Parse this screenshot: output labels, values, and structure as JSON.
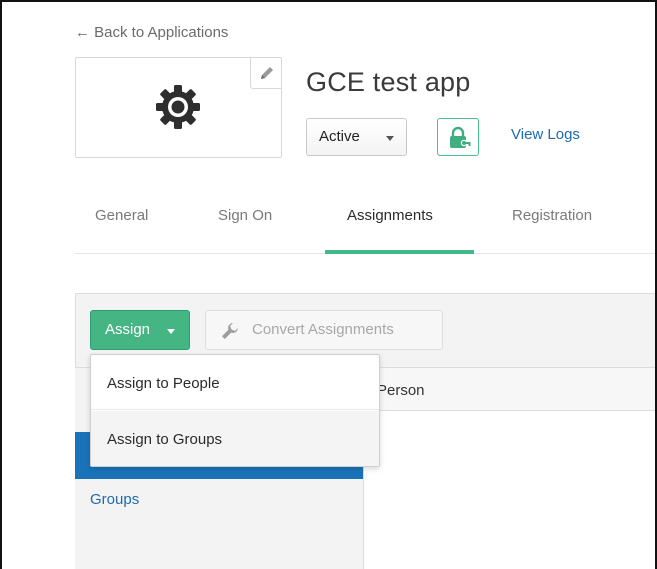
{
  "header": {
    "back_link": "← Back to Applications",
    "app_title": "GCE test app",
    "status": "Active",
    "view_logs": "View Logs"
  },
  "tabs": [
    {
      "label": "General",
      "active": false
    },
    {
      "label": "Sign On",
      "active": false
    },
    {
      "label": "Assignments",
      "active": true
    },
    {
      "label": "Registration",
      "active": false
    }
  ],
  "toolbar": {
    "assign_label": "Assign",
    "convert_label": "Convert Assignments"
  },
  "dropdown": {
    "items": [
      {
        "label": "Assign to People"
      },
      {
        "label": "Assign to Groups"
      }
    ]
  },
  "table": {
    "column_header": "Person"
  },
  "filters": {
    "groups_label": "Groups"
  },
  "colors": {
    "accent_green": "#46b584",
    "link_blue": "#1c6bb0",
    "active_filter_blue": "#1a73b8",
    "tab_underline": "#41b88a"
  },
  "icons": [
    "gear-icon",
    "pencil-icon",
    "lock-key-icon",
    "wrench-icon",
    "caret-down-icon"
  ]
}
